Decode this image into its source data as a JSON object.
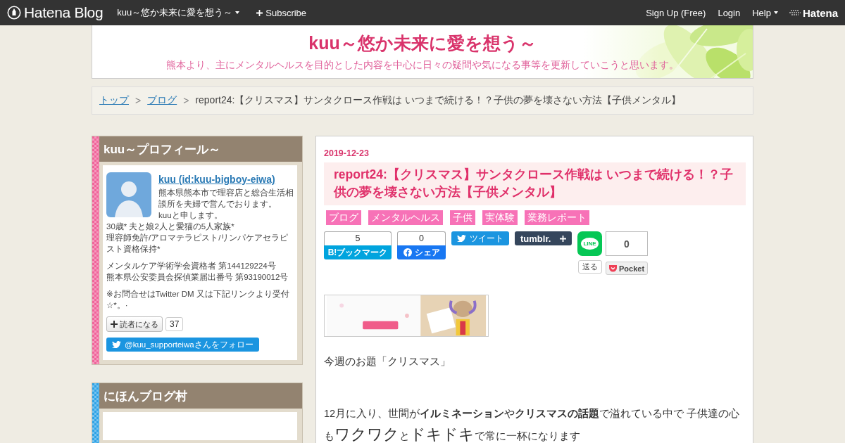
{
  "topbar": {
    "logo": "Hatena Blog",
    "blog_menu": "kuu～悠か未来に愛を想う～",
    "subscribe": "Subscribe",
    "links": [
      {
        "label": "Sign Up (Free)",
        "kind": "link"
      },
      {
        "label": "Login",
        "kind": "link"
      },
      {
        "label": "Help",
        "kind": "menu"
      }
    ],
    "brand": "Hatena"
  },
  "header": {
    "title": "kuu～悠か未来に愛を想う～",
    "description": "熊本より、主にメンタルヘルスを目的とした内容を中心に日々の疑問や気になる事等を更新していこうと思います。"
  },
  "breadcrumb": {
    "separator": ">",
    "items": [
      {
        "label": "トップ",
        "kind": "link"
      },
      {
        "label": "ブログ",
        "kind": "link"
      },
      {
        "label": "report24:【クリスマス】サンタクロース作戦は いつまで続ける！？子供の夢を壊さない方法【子供メンタル】",
        "kind": "current"
      }
    ]
  },
  "sidebar": [
    {
      "kind": "profile",
      "title": "kuu～プロフィール～",
      "color": "#f0649a",
      "name": "kuu (id:kuu-bigboy-eiwa)",
      "intro_lines": [
        "熊本県熊本市で理容店と総合生活相談所を夫婦で営んでおります。",
        "kuuと申します。"
      ],
      "bio_lines": [
        "30歳* 夫と娘2人と愛猫の5人家族*",
        "理容師免許/アロマテラピスト/リンパケアセラピスト資格保持*"
      ],
      "paragraphs": [
        [
          "メンタルケア学術学会資格者 第144129224号",
          "熊本県公安委員会探偵業届出番号 第93190012号"
        ],
        [
          "※お問合せはTwitter DM 又は下記リンクより受付☆*。·"
        ]
      ],
      "subscribe_label": "読者になる",
      "subscribe_count": "37",
      "follow_label": "@kuu_supporteiwaさんをフォロー"
    },
    {
      "kind": "plain",
      "title": "にほんブログ村",
      "color": "#2ea3e6"
    }
  ],
  "entry": {
    "date": "2019-12-23",
    "title": "report24:【クリスマス】サンタクロース作戦は いつまで続ける！？子供の夢を壊さない方法【子供メンタル】",
    "categories": [
      "ブログ",
      "メンタルヘルス",
      "子供",
      "実体験",
      "業務レポート"
    ],
    "share": {
      "hatena_count": "5",
      "hatena_label": "B!ブックマーク",
      "facebook_count": "0",
      "facebook_label": "シェア",
      "tweet_label": "ツイート",
      "tumblr_label": "tumblr.",
      "line_label": "LINE",
      "line_send": "送る",
      "pocket_count": "0",
      "pocket_label": "Pocket"
    },
    "paragraphs": [
      [
        {
          "text": "今週のお題「クリスマス」",
          "kind": "plain"
        }
      ],
      [
        {
          "text": "12月に入り、世間が",
          "kind": "plain"
        },
        {
          "text": "イルミネーション",
          "kind": "bold"
        },
        {
          "text": "や",
          "kind": "plain"
        },
        {
          "text": "クリスマスの話題",
          "kind": "bold"
        },
        {
          "text": "で溢れている中で 子供達の心も",
          "kind": "plain"
        },
        {
          "text": "ワクワク",
          "kind": "large"
        },
        {
          "text": "と",
          "kind": "plain"
        },
        {
          "text": "ドキドキ",
          "kind": "large"
        },
        {
          "text": "で常に一杯になります",
          "kind": "plain"
        }
      ]
    ]
  }
}
